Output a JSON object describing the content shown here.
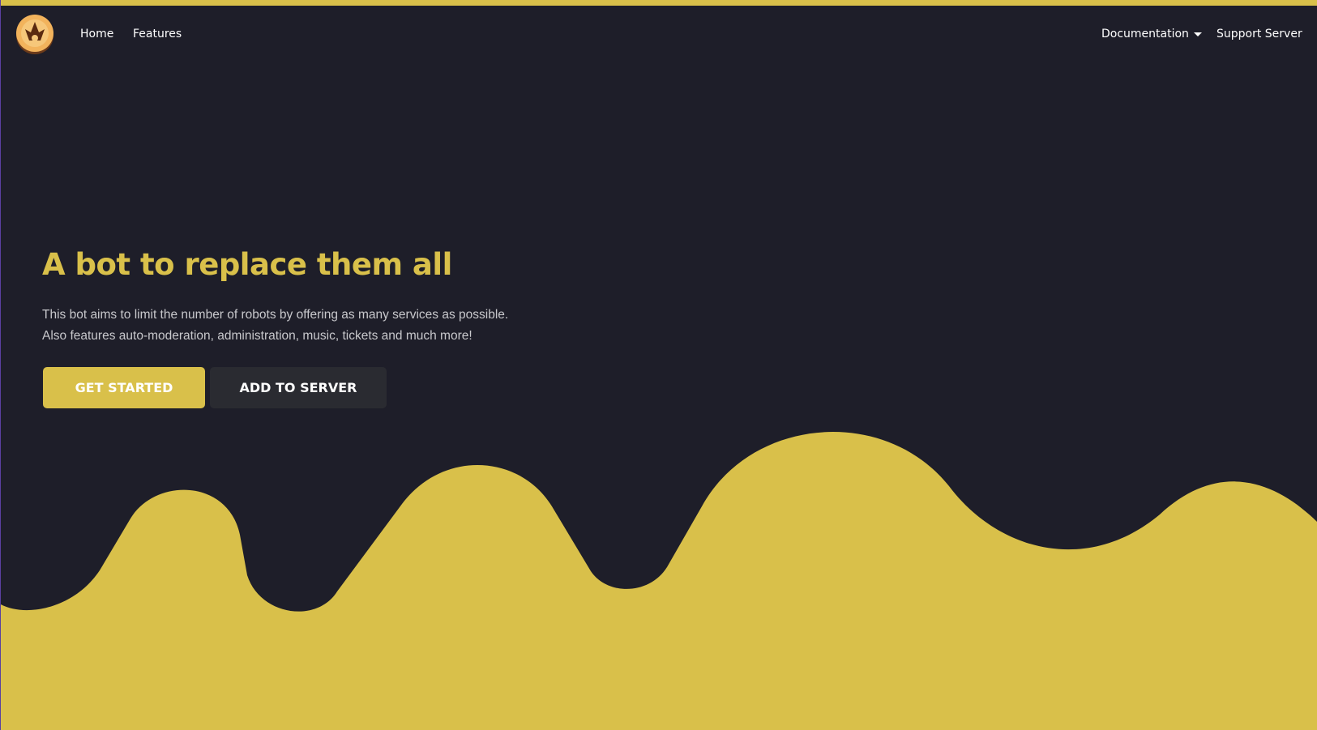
{
  "nav": {
    "home": "Home",
    "features": "Features",
    "documentation": "Documentation",
    "support": "Support Server"
  },
  "hero": {
    "title": "A bot to replace them all",
    "desc_line1": "This bot aims to limit the number of robots by offering as many services as possible.",
    "desc_line2": "Also features auto-moderation, administration, music, tickets and much more!",
    "primary_button": "GET STARTED",
    "secondary_button": "ADD TO SERVER"
  },
  "icons": {
    "logo": "bot-logo-icon",
    "dropdown": "chevron-down-icon"
  },
  "colors": {
    "background": "#1e1e29",
    "accent": "#d9c04a",
    "secondary_button": "#2a2b31",
    "text": "#ffffff"
  }
}
